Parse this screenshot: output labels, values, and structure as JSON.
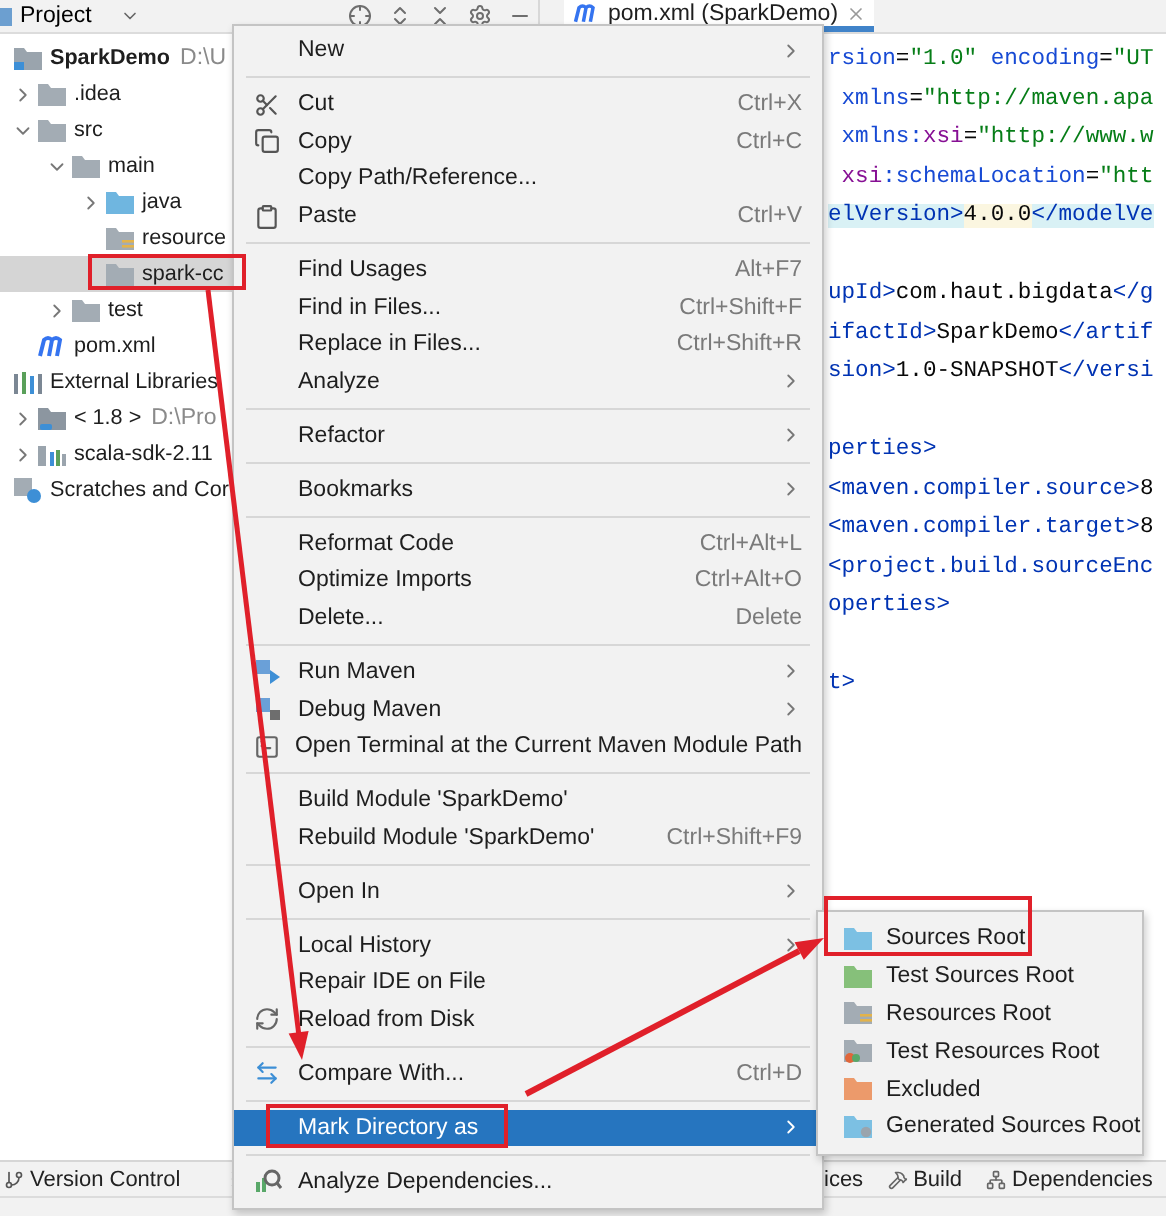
{
  "project_panel": {
    "title": "Project",
    "tree": [
      {
        "label": "SparkDemo",
        "hint": "D:\\U",
        "kind": "module",
        "selected": false,
        "children": [
          {
            "label": ".idea",
            "kind": "folder",
            "expanded": false,
            "selected": false
          },
          {
            "label": "src",
            "kind": "folder",
            "expanded": true,
            "selected": false,
            "children": [
              {
                "label": "main",
                "kind": "folder",
                "expanded": true,
                "selected": false,
                "children": [
                  {
                    "label": "java",
                    "kind": "source-folder",
                    "expanded": false,
                    "selected": false
                  },
                  {
                    "label": "resource",
                    "kind": "resource-folder",
                    "selected": false
                  },
                  {
                    "label": "spark-cc",
                    "kind": "folder",
                    "selected": true
                  }
                ]
              },
              {
                "label": "test",
                "kind": "folder",
                "expanded": false,
                "selected": false
              }
            ]
          },
          {
            "label": "pom.xml",
            "kind": "maven-file",
            "selected": false
          }
        ]
      },
      {
        "label": "External Libraries",
        "kind": "libraries",
        "selected": false,
        "children": [
          {
            "label": "< 1.8 >",
            "hint": "D:\\Pro",
            "kind": "jdk",
            "expanded": false,
            "selected": false
          },
          {
            "label": "scala-sdk-2.11",
            "kind": "sdk",
            "expanded": false,
            "selected": false
          }
        ]
      },
      {
        "label": "Scratches and Cor",
        "kind": "scratches",
        "selected": false
      }
    ]
  },
  "editor": {
    "tab": {
      "label": "pom.xml (SparkDemo)",
      "selected": true
    },
    "code_lines": [
      {
        "kind": "code",
        "segments": [
          {
            "text": "rsion",
            "kind": "attr"
          },
          {
            "text": "=",
            "kind": "plain"
          },
          {
            "text": "\"1.0\"",
            "kind": "string"
          },
          {
            "text": " encoding",
            "kind": "attr"
          },
          {
            "text": "=",
            "kind": "plain"
          },
          {
            "text": "\"UT",
            "kind": "string"
          }
        ]
      },
      {
        "kind": "code",
        "segments": [
          {
            "text": " xmlns",
            "kind": "attr"
          },
          {
            "text": "=",
            "kind": "plain"
          },
          {
            "text": "\"http://maven.apa",
            "kind": "string"
          }
        ]
      },
      {
        "kind": "code",
        "segments": [
          {
            "text": " xmlns:",
            "kind": "attr"
          },
          {
            "text": "xsi",
            "kind": "ns"
          },
          {
            "text": "=",
            "kind": "plain"
          },
          {
            "text": "\"http://www.w",
            "kind": "string"
          }
        ]
      },
      {
        "kind": "code",
        "segments": [
          {
            "text": " xsi",
            "kind": "ns"
          },
          {
            "text": ":schemaLocation",
            "kind": "attr"
          },
          {
            "text": "=",
            "kind": "plain"
          },
          {
            "text": "\"htt",
            "kind": "string"
          }
        ]
      },
      {
        "kind": "code",
        "segments": [
          {
            "text": "elVersion>",
            "kind": "tag-match"
          },
          {
            "text": "4.0.0",
            "kind": "text-match"
          },
          {
            "text": "</modelVe",
            "kind": "tag-match"
          }
        ]
      },
      {
        "kind": "blank"
      },
      {
        "kind": "code",
        "segments": [
          {
            "text": "upId>",
            "kind": "tag"
          },
          {
            "text": "com.haut.bigdata",
            "kind": "plain"
          },
          {
            "text": "</g",
            "kind": "tag"
          }
        ]
      },
      {
        "kind": "code",
        "segments": [
          {
            "text": "ifactId>",
            "kind": "tag"
          },
          {
            "text": "SparkDemo",
            "kind": "plain"
          },
          {
            "text": "</artif",
            "kind": "tag"
          }
        ]
      },
      {
        "kind": "code",
        "segments": [
          {
            "text": "sion>",
            "kind": "tag"
          },
          {
            "text": "1.0-SNAPSHOT",
            "kind": "plain"
          },
          {
            "text": "</versi",
            "kind": "tag"
          }
        ]
      },
      {
        "kind": "blank"
      },
      {
        "kind": "code",
        "segments": [
          {
            "text": "perties>",
            "kind": "tag"
          }
        ]
      },
      {
        "kind": "code",
        "segments": [
          {
            "text": "<maven.compiler.source>",
            "kind": "tag"
          },
          {
            "text": "8",
            "kind": "plain"
          }
        ]
      },
      {
        "kind": "code",
        "segments": [
          {
            "text": "<maven.compiler.target>",
            "kind": "tag"
          },
          {
            "text": "8",
            "kind": "plain"
          }
        ]
      },
      {
        "kind": "code",
        "segments": [
          {
            "text": "<project.build.sourceEnc",
            "kind": "tag"
          }
        ]
      },
      {
        "kind": "code",
        "segments": [
          {
            "text": "operties>",
            "kind": "tag"
          }
        ]
      },
      {
        "kind": "blank"
      },
      {
        "kind": "code",
        "segments": [
          {
            "text": "t>",
            "kind": "tag"
          }
        ]
      }
    ]
  },
  "context_menu": {
    "entries": [
      {
        "kind": "item",
        "label": "New",
        "submenu": true,
        "selected": false
      },
      {
        "kind": "separator"
      },
      {
        "kind": "item",
        "label": "Cut",
        "shortcut": "Ctrl+X",
        "submenu": false,
        "selected": false
      },
      {
        "kind": "item",
        "label": "Copy",
        "shortcut": "Ctrl+C",
        "submenu": false,
        "selected": false
      },
      {
        "kind": "item",
        "label": "Copy Path/Reference...",
        "submenu": false,
        "selected": false
      },
      {
        "kind": "item",
        "label": "Paste",
        "shortcut": "Ctrl+V",
        "submenu": false,
        "selected": false
      },
      {
        "kind": "separator"
      },
      {
        "kind": "item",
        "label": "Find Usages",
        "shortcut": "Alt+F7",
        "submenu": false,
        "selected": false
      },
      {
        "kind": "item",
        "label": "Find in Files...",
        "shortcut": "Ctrl+Shift+F",
        "submenu": false,
        "selected": false
      },
      {
        "kind": "item",
        "label": "Replace in Files...",
        "shortcut": "Ctrl+Shift+R",
        "submenu": false,
        "selected": false
      },
      {
        "kind": "item",
        "label": "Analyze",
        "submenu": true,
        "selected": false
      },
      {
        "kind": "separator"
      },
      {
        "kind": "item",
        "label": "Refactor",
        "submenu": true,
        "selected": false
      },
      {
        "kind": "separator"
      },
      {
        "kind": "item",
        "label": "Bookmarks",
        "submenu": true,
        "selected": false
      },
      {
        "kind": "separator"
      },
      {
        "kind": "item",
        "label": "Reformat Code",
        "shortcut": "Ctrl+Alt+L",
        "submenu": false,
        "selected": false
      },
      {
        "kind": "item",
        "label": "Optimize Imports",
        "shortcut": "Ctrl+Alt+O",
        "submenu": false,
        "selected": false
      },
      {
        "kind": "item",
        "label": "Delete...",
        "shortcut": "Delete",
        "submenu": false,
        "selected": false
      },
      {
        "kind": "separator"
      },
      {
        "kind": "item",
        "label": "Run Maven",
        "submenu": true,
        "selected": false
      },
      {
        "kind": "item",
        "label": "Debug Maven",
        "submenu": true,
        "selected": false
      },
      {
        "kind": "item",
        "label": "Open Terminal at the Current Maven Module Path",
        "submenu": false,
        "selected": false
      },
      {
        "kind": "separator"
      },
      {
        "kind": "item",
        "label": "Build Module 'SparkDemo'",
        "submenu": false,
        "selected": false
      },
      {
        "kind": "item",
        "label": "Rebuild Module 'SparkDemo'",
        "shortcut": "Ctrl+Shift+F9",
        "submenu": false,
        "selected": false
      },
      {
        "kind": "separator"
      },
      {
        "kind": "item",
        "label": "Open In",
        "submenu": true,
        "selected": false
      },
      {
        "kind": "separator"
      },
      {
        "kind": "item",
        "label": "Local History",
        "submenu": true,
        "selected": false
      },
      {
        "kind": "item",
        "label": "Repair IDE on File",
        "submenu": false,
        "selected": false
      },
      {
        "kind": "item",
        "label": "Reload from Disk",
        "submenu": false,
        "selected": false
      },
      {
        "kind": "separator"
      },
      {
        "kind": "item",
        "label": "Compare With...",
        "shortcut": "Ctrl+D",
        "submenu": false,
        "selected": false
      },
      {
        "kind": "separator"
      },
      {
        "kind": "item",
        "label": "Mark Directory as",
        "submenu": true,
        "selected": true
      },
      {
        "kind": "separator"
      },
      {
        "kind": "item",
        "label": "Analyze Dependencies...",
        "submenu": false,
        "selected": false
      }
    ]
  },
  "submenu": {
    "items": [
      {
        "label": "Sources Root",
        "kind": "sources"
      },
      {
        "label": "Test Sources Root",
        "kind": "test-sources"
      },
      {
        "label": "Resources Root",
        "kind": "resources"
      },
      {
        "label": "Test Resources Root",
        "kind": "test-resources"
      },
      {
        "label": "Excluded",
        "kind": "excluded"
      },
      {
        "label": "Generated Sources Root",
        "kind": "generated"
      }
    ]
  },
  "tool_window_bar": {
    "left": [
      "Version Control"
    ],
    "right": [
      "ices",
      "Build",
      "Dependencies"
    ]
  }
}
